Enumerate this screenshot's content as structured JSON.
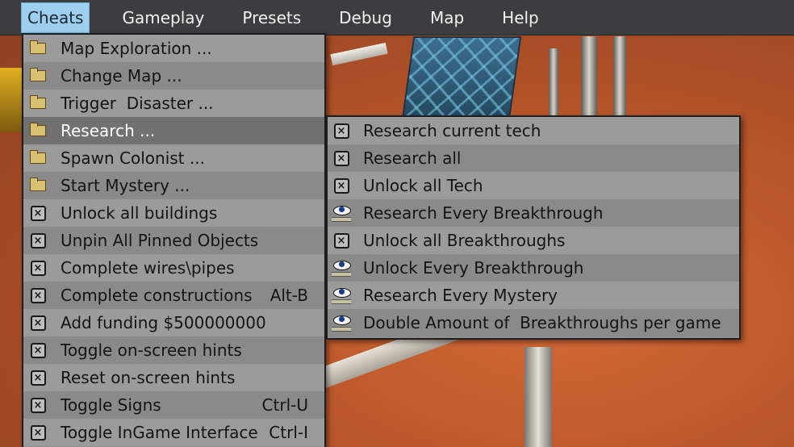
{
  "menubar": {
    "items": [
      {
        "label": "Cheats",
        "active": true
      },
      {
        "label": "Gameplay"
      },
      {
        "label": "Presets"
      },
      {
        "label": "Debug"
      },
      {
        "label": "Map"
      },
      {
        "label": "Help"
      }
    ]
  },
  "cheats_menu": {
    "items": [
      {
        "icon": "folder-icon",
        "label": "Map Exploration ...",
        "shortcut": ""
      },
      {
        "icon": "folder-icon",
        "label": "Change Map ...",
        "shortcut": ""
      },
      {
        "icon": "folder-icon",
        "label": "Trigger  Disaster ...",
        "shortcut": ""
      },
      {
        "icon": "folder-icon",
        "label": "Research ...",
        "shortcut": "",
        "highlighted": true
      },
      {
        "icon": "folder-icon",
        "label": "Spawn Colonist ...",
        "shortcut": ""
      },
      {
        "icon": "folder-icon",
        "label": "Start Mystery ...",
        "shortcut": ""
      },
      {
        "icon": "checkbox-x-icon",
        "label": "Unlock all buildings",
        "shortcut": ""
      },
      {
        "icon": "checkbox-x-icon",
        "label": "Unpin All Pinned Objects",
        "shortcut": ""
      },
      {
        "icon": "checkbox-x-icon",
        "label": "Complete wires\\pipes",
        "shortcut": ""
      },
      {
        "icon": "checkbox-x-icon",
        "label": "Complete constructions",
        "shortcut": "Alt-B"
      },
      {
        "icon": "checkbox-x-icon",
        "label": "Add funding $500000000",
        "shortcut": ""
      },
      {
        "icon": "checkbox-x-icon",
        "label": "Toggle on-screen hints",
        "shortcut": ""
      },
      {
        "icon": "checkbox-x-icon",
        "label": "Reset on-screen hints",
        "shortcut": ""
      },
      {
        "icon": "checkbox-x-icon",
        "label": "Toggle Signs",
        "shortcut": "Ctrl-U"
      },
      {
        "icon": "checkbox-x-icon",
        "label": "Toggle InGame Interface",
        "shortcut": "Ctrl-I"
      }
    ]
  },
  "research_menu": {
    "items": [
      {
        "icon": "checkbox-x-icon",
        "label": "Research current tech"
      },
      {
        "icon": "checkbox-x-icon",
        "label": "Research all"
      },
      {
        "icon": "checkbox-x-icon",
        "label": "Unlock all Tech"
      },
      {
        "icon": "eye-icon",
        "label": "Research Every Breakthrough"
      },
      {
        "icon": "checkbox-x-icon",
        "label": "Unlock all Breakthroughs"
      },
      {
        "icon": "eye-icon",
        "label": "Unlock Every Breakthrough"
      },
      {
        "icon": "eye-icon",
        "label": "Research Every Mystery"
      },
      {
        "icon": "eye-icon",
        "label": "Double Amount of  Breakthroughs per game"
      }
    ]
  },
  "colors": {
    "menubar_bg": "#3d3d3f",
    "active_menu_bg": "#9dd0ee",
    "menu_bg": "#8e8e8e",
    "highlight_row": "#717171"
  }
}
